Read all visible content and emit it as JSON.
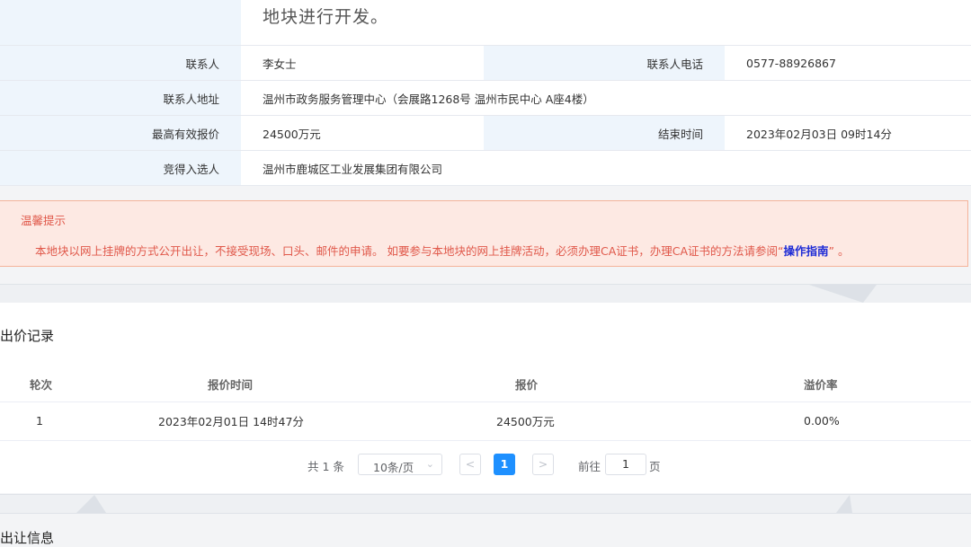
{
  "info": {
    "description_tail": "地块进行开发。",
    "contact_label": "联系人",
    "contact_value": "李女士",
    "phone_label": "联系人电话",
    "phone_value": "0577-88926867",
    "address_label": "联系人地址",
    "address_value": "温州市政务服务管理中心（会展路1268号 温州市民中心 A座4楼）",
    "max_bid_label": "最高有效报价",
    "max_bid_value": "24500万元",
    "end_time_label": "结束时间",
    "end_time_value": "2023年02月03日 09时14分",
    "winner_label": "竞得入选人",
    "winner_value": "温州市鹿城区工业发展集团有限公司"
  },
  "tip": {
    "title": "温馨提示",
    "text_before": "本地块以网上挂牌的方式公开出让，不接受现场、口头、邮件的申请。 如要参与本地块的网上挂牌活动，必须办理CA证书，办理CA证书的方法请参阅“",
    "link": "操作指南",
    "text_after": "” 。"
  },
  "bids": {
    "title": "出价记录",
    "columns": [
      "轮次",
      "报价时间",
      "报价",
      "溢价率"
    ],
    "rows": [
      [
        "1",
        "2023年02月01日 14时47分",
        "24500万元",
        "0.00%"
      ]
    ]
  },
  "pagination": {
    "total": "共 1 条",
    "page_size": "10条/页",
    "current_page": "1",
    "goto_label": "前往",
    "goto_value": "1",
    "page_unit": "页",
    "prev_icon": "chevron-left-icon",
    "next_icon": "chevron-right-icon",
    "dropdown_icon": "chevron-down-icon"
  },
  "next_section_title": "出让信息",
  "colors": {
    "label_bg": "#eef5fc",
    "tip_bg": "#fde9e3",
    "tip_border": "#f5b39a",
    "tip_text": "#e0584a",
    "link": "#1d2bd6",
    "active_page": "#1e90ff"
  }
}
